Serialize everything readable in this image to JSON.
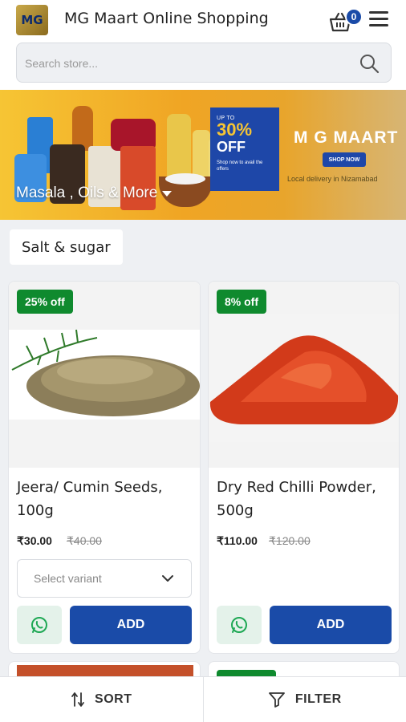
{
  "header": {
    "logo_text": "MG",
    "title": "MG Maart Online Shopping",
    "cart_count": "0"
  },
  "search": {
    "placeholder": "Search store..."
  },
  "banner": {
    "label": "Masala , Oils & More",
    "offer_up_to": "UP TO",
    "offer_percent": "30%",
    "offer_off": "OFF",
    "offer_note": "Shop now to avail the offers",
    "brand": "M G MAART",
    "shop_now": "SHOP NOW",
    "delivery_note": "Local delivery in Nizamabad"
  },
  "category_chip": "Salt & sugar",
  "products": [
    {
      "discount": "25% off",
      "name": "Jeera/ Cumin Seeds, 100g",
      "price": "₹30.00",
      "mrp": "₹40.00",
      "variant_placeholder": "Select variant",
      "add_label": "ADD"
    },
    {
      "discount": "8% off",
      "name": "Dry Red Chilli Powder, 500g",
      "price": "₹110.00",
      "mrp": "₹120.00",
      "add_label": "ADD"
    }
  ],
  "bottom_bar": {
    "sort_label": "SORT",
    "filter_label": "FILTER"
  },
  "colors": {
    "primary": "#1a4ba8",
    "discount": "#0f8a2e",
    "whatsapp": "#1fa855"
  }
}
